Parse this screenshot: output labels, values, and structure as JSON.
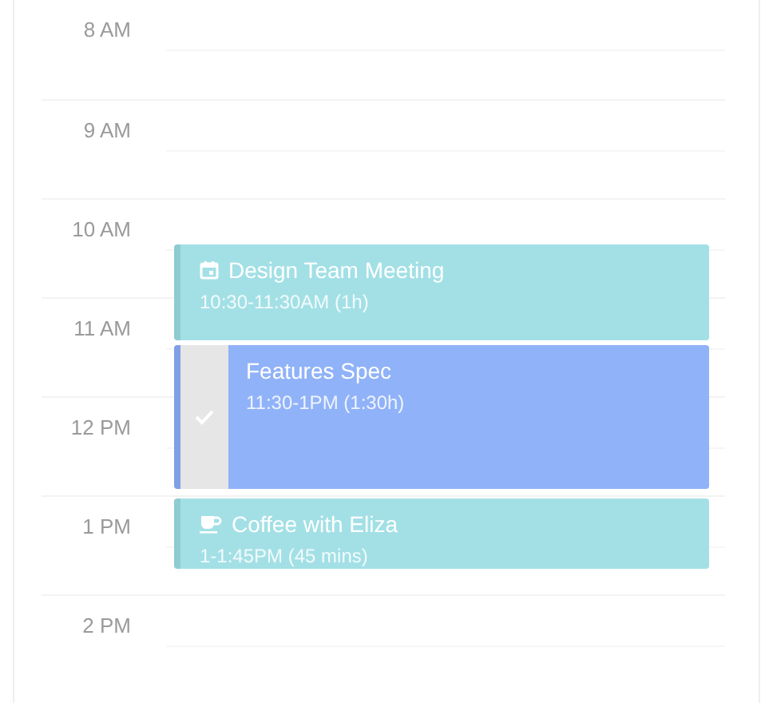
{
  "hours": [
    "8 AM",
    "9 AM",
    "10 AM",
    "11 AM",
    "12 PM",
    "1 PM",
    "2 PM"
  ],
  "events": [
    {
      "kind": "meeting",
      "title": "Design Team Meeting",
      "time": "10:30-11:30AM (1h)",
      "color": "#a3e0e6"
    },
    {
      "kind": "task",
      "title": "Features Spec",
      "time": "11:30-1PM (1:30h)",
      "color": "#90b2f8",
      "completed": true
    },
    {
      "kind": "break",
      "title": "Coffee with Eliza",
      "time": "1-1:45PM (45 mins)",
      "color": "#a3e0e6"
    }
  ]
}
